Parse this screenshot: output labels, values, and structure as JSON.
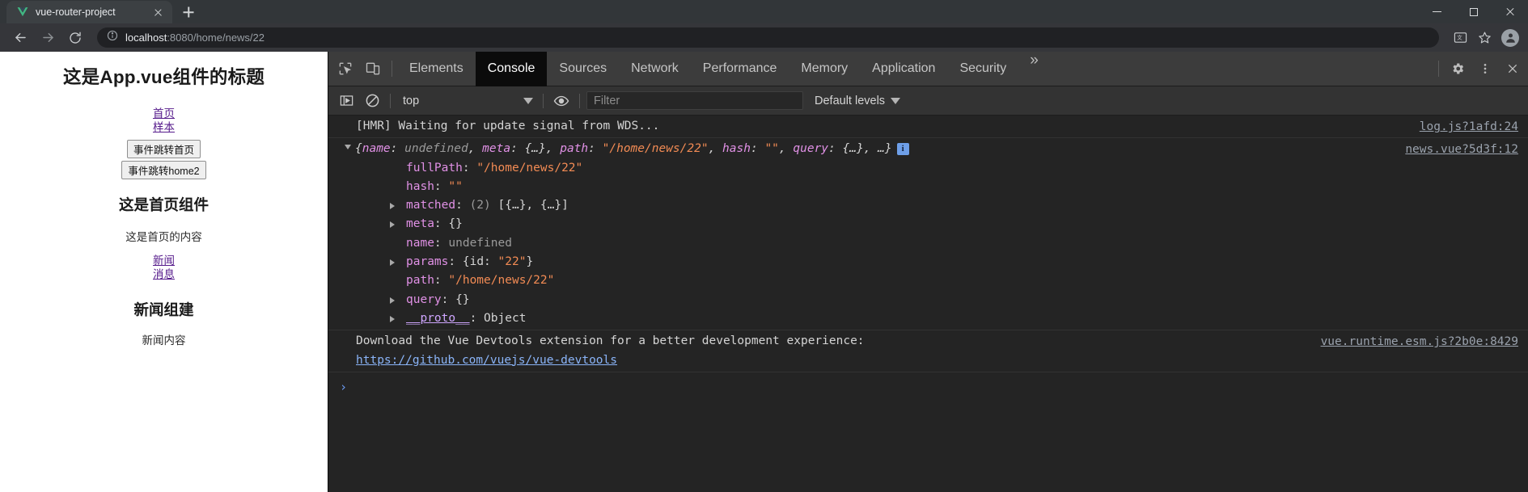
{
  "browser": {
    "tab": {
      "title": "vue-router-project",
      "favicon": "vue-logo-icon"
    },
    "new_tab_label": "+",
    "window_controls": {
      "minimize": "minimize-icon",
      "maximize": "maximize-icon",
      "close": "close-icon"
    },
    "nav": {
      "back": "back-arrow-icon",
      "forward": "forward-arrow-icon",
      "reload": "reload-icon"
    },
    "omnibox": {
      "info_icon": "info-circle-icon",
      "url_host": "localhost",
      "url_rest": ":8080/home/news/22",
      "full_url": "localhost:8080/home/news/22"
    },
    "toolbar_right": {
      "translate": "translate-icon",
      "bookmark": "star-icon",
      "profile": "avatar-icon"
    }
  },
  "page": {
    "app_title": "这是App.vue组件的标题",
    "nav_links": [
      {
        "label": "首页"
      },
      {
        "label": "样本"
      }
    ],
    "buttons": [
      {
        "label": "事件跳转首页"
      },
      {
        "label": "事件跳转home2"
      }
    ],
    "home_title": "这是首页组件",
    "home_text": "这是首页的内容",
    "sub_links": [
      {
        "label": "新闻"
      },
      {
        "label": "消息"
      }
    ],
    "news_title": "新闻组建",
    "news_text": "新闻内容"
  },
  "devtools": {
    "inspect_icon": "inspect-element-icon",
    "device_icon": "device-toolbar-icon",
    "tabs": [
      {
        "label": "Elements",
        "active": false
      },
      {
        "label": "Console",
        "active": true
      },
      {
        "label": "Sources",
        "active": false
      },
      {
        "label": "Network",
        "active": false
      },
      {
        "label": "Performance",
        "active": false
      },
      {
        "label": "Memory",
        "active": false
      },
      {
        "label": "Application",
        "active": false
      },
      {
        "label": "Security",
        "active": false
      }
    ],
    "more_tabs_icon": "double-chevron-right-icon",
    "settings_icon": "gear-icon",
    "menu_icon": "kebab-menu-icon",
    "close_devtools_icon": "close-icon",
    "filter_bar": {
      "sidebar_toggle_icon": "console-sidebar-icon",
      "clear_console_icon": "clear-console-icon",
      "context_value": "top",
      "context_caret": "caret-down-icon",
      "eye_icon": "live-expression-icon",
      "filter_placeholder": "Filter",
      "filter_value": "",
      "levels_label": "Default levels",
      "levels_caret": "caret-down-icon"
    },
    "console": {
      "hmr": {
        "message": "[HMR] Waiting for update signal from WDS...",
        "source": "log.js?1afd:24"
      },
      "route_object": {
        "source": "news.vue?5d3f:12",
        "preview_open": "{",
        "preview": [
          {
            "key": "name",
            "sep": ": ",
            "value": "undefined",
            "kind": "undefined",
            "trail": ", "
          },
          {
            "key": "meta",
            "sep": ": ",
            "value": "{…}",
            "kind": "punc",
            "trail": ", "
          },
          {
            "key": "path",
            "sep": ": ",
            "value": "\"/home/news/22\"",
            "kind": "string",
            "trail": ", "
          },
          {
            "key": "hash",
            "sep": ": ",
            "value": "\"\"",
            "kind": "string",
            "trail": ", "
          },
          {
            "key": "query",
            "sep": ": ",
            "value": "{…}",
            "kind": "punc",
            "trail": ", "
          },
          {
            "key": "",
            "sep": "",
            "value": "…",
            "kind": "punc",
            "trail": ""
          }
        ],
        "preview_close": "}",
        "badge": "i",
        "properties": [
          {
            "expandable": false,
            "key": "fullPath",
            "value": "\"/home/news/22\"",
            "kind": "string"
          },
          {
            "expandable": false,
            "key": "hash",
            "value": "\"\"",
            "kind": "string"
          },
          {
            "expandable": true,
            "key": "matched",
            "count": "(2)",
            "value": "[{…}, {…}]",
            "kind": "punc"
          },
          {
            "expandable": true,
            "key": "meta",
            "value": "{}",
            "kind": "punc"
          },
          {
            "expandable": false,
            "key": "name",
            "value": "undefined",
            "kind": "undefined"
          },
          {
            "expandable": true,
            "key": "params",
            "value": "{id: \"22\"}",
            "kind": "mixed",
            "mixed_pre": "{id: ",
            "mixed_str": "\"22\"",
            "mixed_post": "}"
          },
          {
            "expandable": false,
            "key": "path",
            "value": "\"/home/news/22\"",
            "kind": "string"
          },
          {
            "expandable": true,
            "key": "query",
            "value": "{}",
            "kind": "punc"
          },
          {
            "expandable": true,
            "key": "__proto__",
            "value": "Object",
            "kind": "proto"
          }
        ]
      },
      "devtools_notice": {
        "line1": "Download the Vue Devtools extension for a better development experience:",
        "line2": "https://github.com/vuejs/vue-devtools",
        "source": "vue.runtime.esm.js?2b0e:8429"
      },
      "prompt_symbol": "›"
    }
  },
  "colors": {
    "accent_blue": "#8ab4f8",
    "string_orange": "#f28b54",
    "key_magenta": "#e191e6",
    "link_purple": "#551a8b",
    "devtools_bg": "#242424"
  }
}
